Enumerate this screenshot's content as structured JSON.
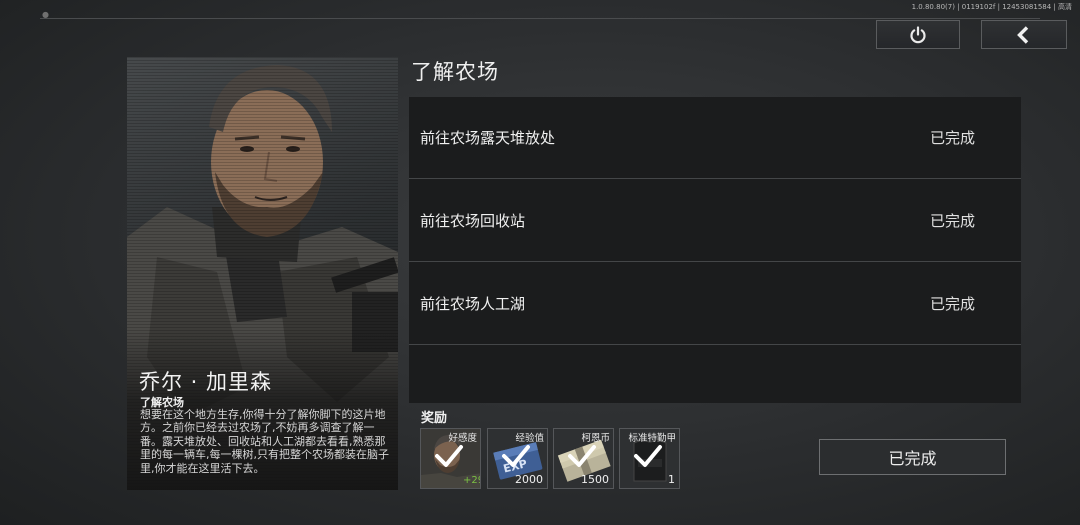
{
  "system": {
    "version_text": "1.0.80.80(7) | 0119102f | 12453081584 | 高清"
  },
  "toolbar": {
    "power_icon": "power-icon",
    "back_icon": "chevron-left-icon"
  },
  "character": {
    "name": "乔尔 · 加里森"
  },
  "quest": {
    "title": "了解农场",
    "subtitle": "了解农场",
    "description": "想要在这个地方生存,你得十分了解你脚下的这片地方。之前你已经去过农场了,不妨再多调查了解一番。露天堆放处、回收站和人工湖都去看看,熟悉那里的每一辆车,每一棵树,只有把整个农场都装在脑子里,你才能在这里活下去。",
    "tasks": [
      {
        "label": "前往农场露天堆放处",
        "status": "已完成"
      },
      {
        "label": "前往农场回收站",
        "status": "已完成"
      },
      {
        "label": "前往农场人工湖",
        "status": "已完成"
      }
    ]
  },
  "rewards": {
    "label": "奖励",
    "items": [
      {
        "name": "好感度",
        "quantity": "+29",
        "icon": "character-portrait-icon"
      },
      {
        "name": "经验值",
        "quantity": "2000",
        "icon": "exp-card-icon"
      },
      {
        "name": "柯恩币",
        "quantity": "1500",
        "icon": "cash-bundle-icon"
      },
      {
        "name": "标准特勤甲",
        "quantity": "1",
        "icon": "body-armor-icon"
      }
    ]
  },
  "actions": {
    "complete_label": "已完成"
  },
  "colors": {
    "background": "#2b2d2f",
    "panel": "#1b1c1d",
    "affinity_green": "#7bc043"
  }
}
